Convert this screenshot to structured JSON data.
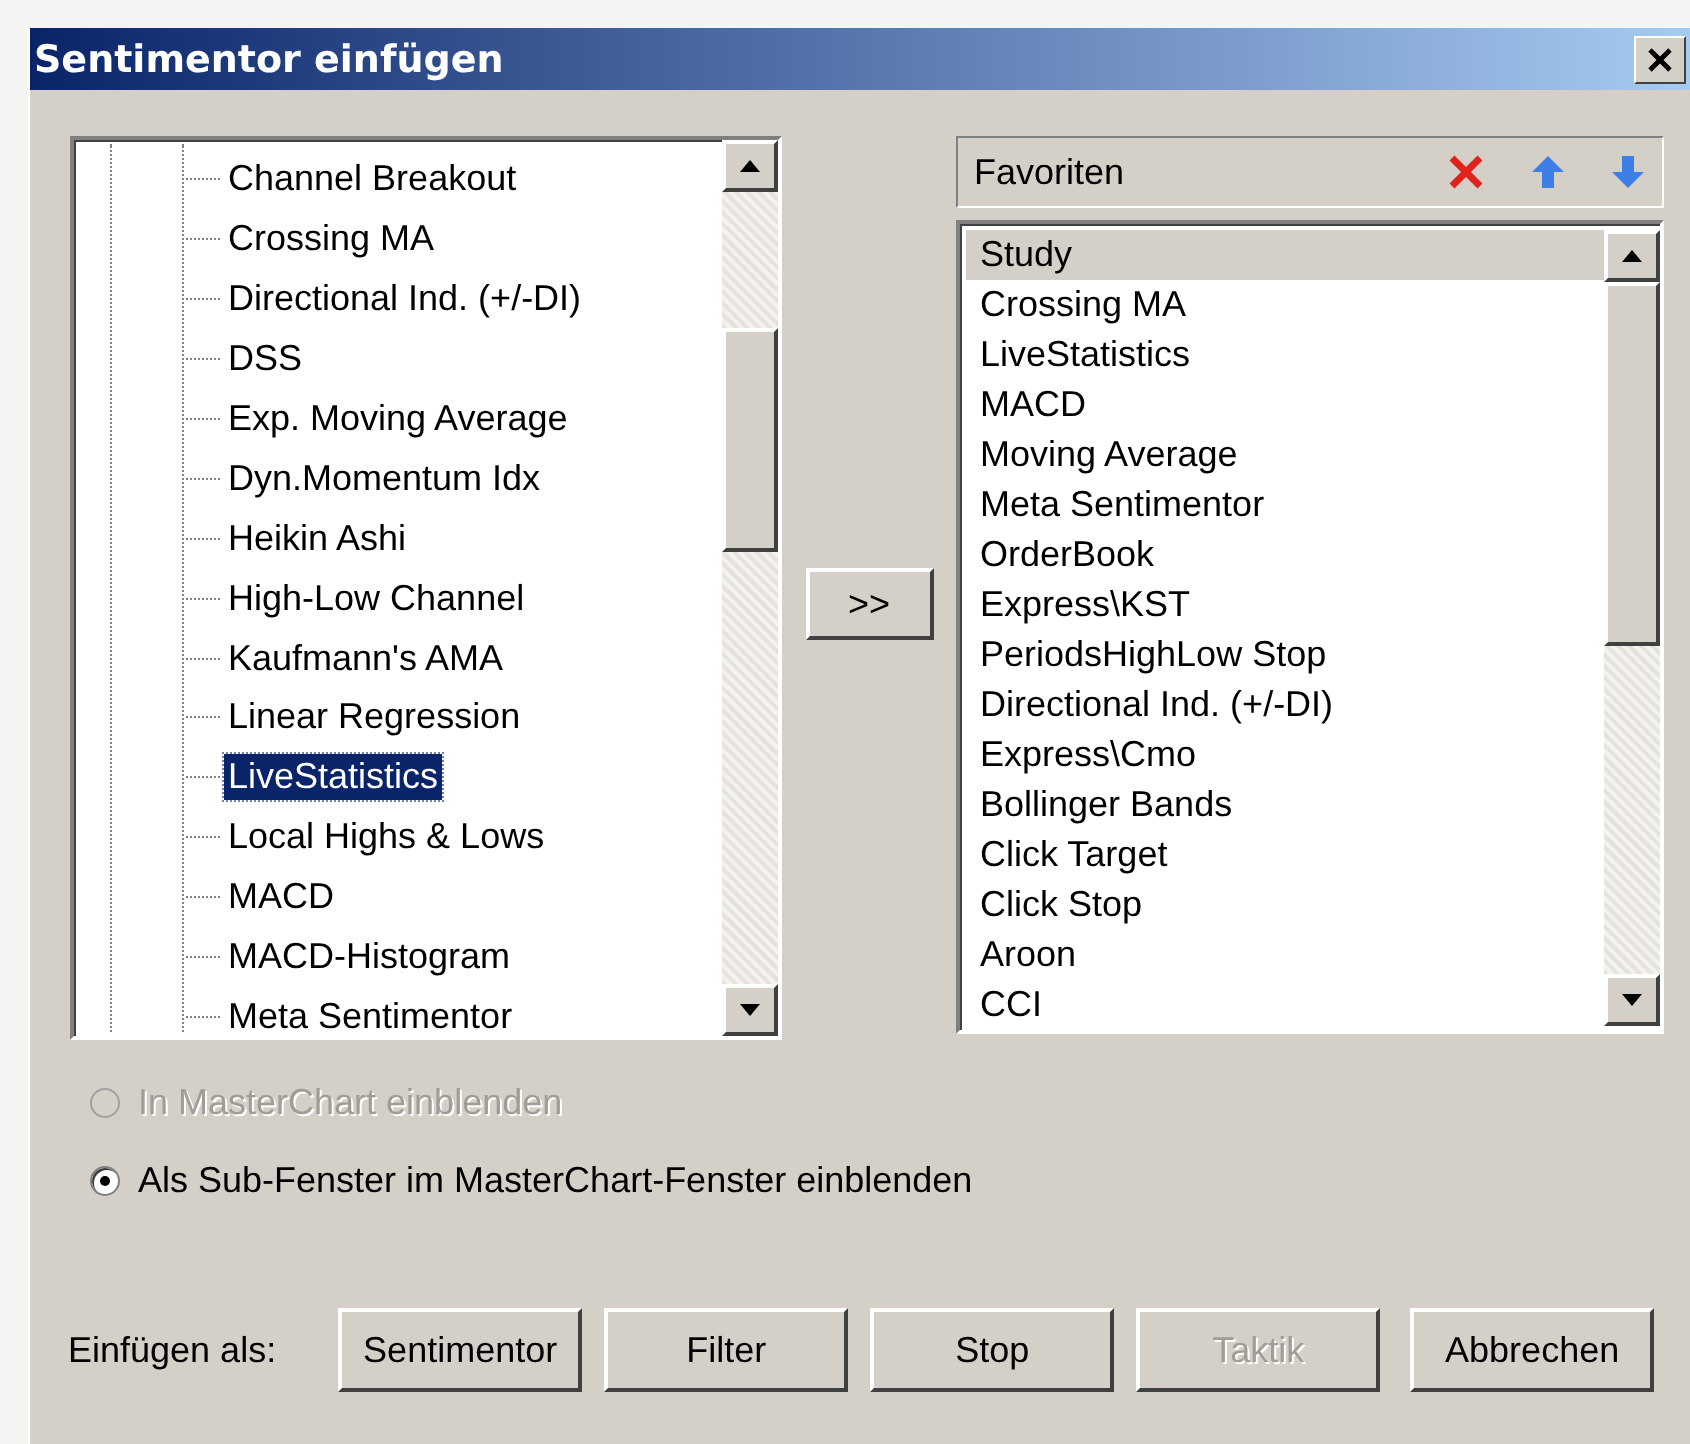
{
  "window": {
    "title": "Sentimentor einfügen"
  },
  "tree": {
    "items": [
      {
        "label": "Channel Breakout",
        "selected": false
      },
      {
        "label": "Crossing MA",
        "selected": false
      },
      {
        "label": "Directional Ind. (+/-DI)",
        "selected": false
      },
      {
        "label": "DSS",
        "selected": false
      },
      {
        "label": "Exp. Moving Average",
        "selected": false
      },
      {
        "label": "Dyn.Momentum Idx",
        "selected": false
      },
      {
        "label": "Heikin Ashi",
        "selected": false
      },
      {
        "label": "High-Low Channel",
        "selected": false
      },
      {
        "label": "Kaufmann's AMA",
        "selected": false
      },
      {
        "label": "Linear Regression",
        "selected": false
      },
      {
        "label": "LiveStatistics",
        "selected": true
      },
      {
        "label": "Local Highs & Lows",
        "selected": false
      },
      {
        "label": "MACD",
        "selected": false
      },
      {
        "label": "MACD-Histogram",
        "selected": false
      },
      {
        "label": "Meta Sentimentor",
        "selected": false
      }
    ]
  },
  "add_button": {
    "label": ">>"
  },
  "favorites": {
    "title": "Favoriten",
    "items": [
      {
        "label": "Study",
        "selected": true
      },
      {
        "label": "Crossing MA",
        "selected": false
      },
      {
        "label": "LiveStatistics",
        "selected": false
      },
      {
        "label": "MACD",
        "selected": false
      },
      {
        "label": "Moving Average",
        "selected": false
      },
      {
        "label": "Meta Sentimentor",
        "selected": false
      },
      {
        "label": "OrderBook",
        "selected": false
      },
      {
        "label": "Express\\KST",
        "selected": false
      },
      {
        "label": "PeriodsHighLow Stop",
        "selected": false
      },
      {
        "label": "Directional Ind. (+/-DI)",
        "selected": false
      },
      {
        "label": "Express\\Cmo",
        "selected": false
      },
      {
        "label": "Bollinger Bands",
        "selected": false
      },
      {
        "label": "Click Target",
        "selected": false
      },
      {
        "label": "Click Stop",
        "selected": false
      },
      {
        "label": "Aroon",
        "selected": false
      },
      {
        "label": "CCI",
        "selected": false
      }
    ]
  },
  "options": [
    {
      "label": "In MasterChart einblenden",
      "selected": false,
      "disabled": true
    },
    {
      "label": "Als Sub-Fenster im MasterChart-Fenster einblenden",
      "selected": true,
      "disabled": false
    }
  ],
  "insert_label": "Einfügen als:",
  "buttons": [
    {
      "label": "Sentimentor",
      "disabled": false
    },
    {
      "label": "Filter",
      "disabled": false
    },
    {
      "label": "Stop",
      "disabled": false
    },
    {
      "label": "Taktik",
      "disabled": true
    },
    {
      "label": "Abbrechen",
      "disabled": false
    }
  ]
}
